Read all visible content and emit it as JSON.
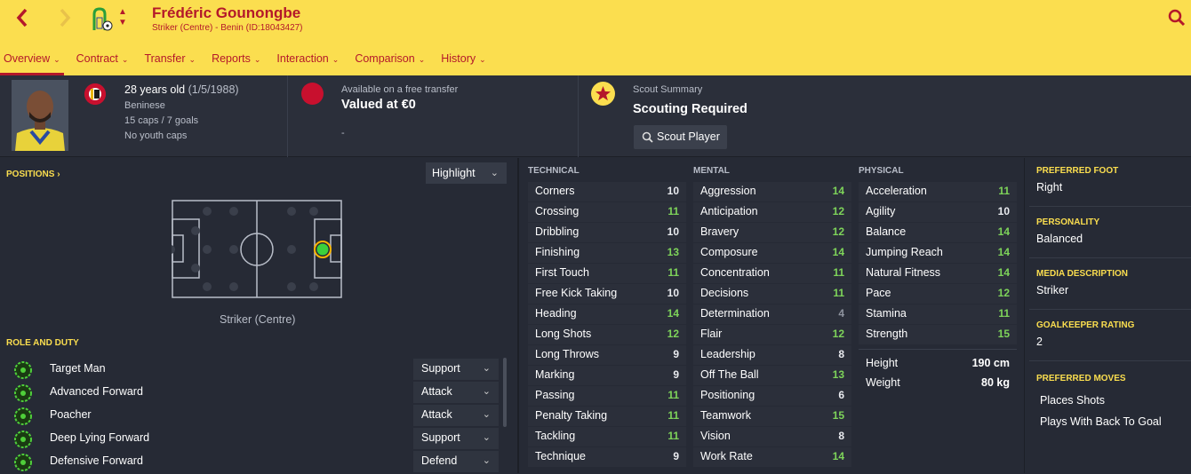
{
  "header": {
    "player_name": "Frédéric Gounongbe",
    "subtitle": "Striker (Centre) - Benin (ID:18043427)",
    "back_icon": "chevron-left-icon",
    "forward_icon": "chevron-right-icon",
    "accent": "#b4182a",
    "background": "#fbde4f"
  },
  "tabs": [
    {
      "label": "Overview",
      "active": true
    },
    {
      "label": "Contract"
    },
    {
      "label": "Transfer"
    },
    {
      "label": "Reports"
    },
    {
      "label": "Interaction"
    },
    {
      "label": "Comparison"
    },
    {
      "label": "History"
    }
  ],
  "profile": {
    "age": "28 years old",
    "dob": "(1/5/1988)",
    "nationality": "Beninese",
    "caps": "15 caps / 7 goals",
    "youth": "No youth caps"
  },
  "transfer": {
    "status": "Available on a free transfer",
    "value": "Valued at €0",
    "extra": "-"
  },
  "scout": {
    "label": "Scout Summary",
    "status": "Scouting Required",
    "button": "Scout Player"
  },
  "positions": {
    "label": "POSITIONS",
    "highlight": "Highlight",
    "position_name": "Striker (Centre)"
  },
  "roles": {
    "label": "ROLE AND DUTY",
    "items": [
      {
        "name": "Target Man",
        "duty": "Support"
      },
      {
        "name": "Advanced Forward",
        "duty": "Attack"
      },
      {
        "name": "Poacher",
        "duty": "Attack"
      },
      {
        "name": "Deep Lying Forward",
        "duty": "Support"
      },
      {
        "name": "Defensive Forward",
        "duty": "Defend"
      }
    ]
  },
  "attributes": {
    "technical_title": "TECHNICAL",
    "mental_title": "MENTAL",
    "physical_title": "PHYSICAL",
    "technical": [
      {
        "name": "Corners",
        "value": "10"
      },
      {
        "name": "Crossing",
        "value": "11"
      },
      {
        "name": "Dribbling",
        "value": "10"
      },
      {
        "name": "Finishing",
        "value": "13"
      },
      {
        "name": "First Touch",
        "value": "11"
      },
      {
        "name": "Free Kick Taking",
        "value": "10"
      },
      {
        "name": "Heading",
        "value": "14"
      },
      {
        "name": "Long Shots",
        "value": "12"
      },
      {
        "name": "Long Throws",
        "value": "9"
      },
      {
        "name": "Marking",
        "value": "9"
      },
      {
        "name": "Passing",
        "value": "11"
      },
      {
        "name": "Penalty Taking",
        "value": "11"
      },
      {
        "name": "Tackling",
        "value": "11"
      },
      {
        "name": "Technique",
        "value": "9"
      }
    ],
    "mental": [
      {
        "name": "Aggression",
        "value": "14"
      },
      {
        "name": "Anticipation",
        "value": "12"
      },
      {
        "name": "Bravery",
        "value": "12"
      },
      {
        "name": "Composure",
        "value": "14"
      },
      {
        "name": "Concentration",
        "value": "11"
      },
      {
        "name": "Decisions",
        "value": "11"
      },
      {
        "name": "Determination",
        "value": "4"
      },
      {
        "name": "Flair",
        "value": "12"
      },
      {
        "name": "Leadership",
        "value": "8"
      },
      {
        "name": "Off The Ball",
        "value": "13"
      },
      {
        "name": "Positioning",
        "value": "6"
      },
      {
        "name": "Teamwork",
        "value": "15"
      },
      {
        "name": "Vision",
        "value": "8"
      },
      {
        "name": "Work Rate",
        "value": "14"
      }
    ],
    "physical": [
      {
        "name": "Acceleration",
        "value": "11"
      },
      {
        "name": "Agility",
        "value": "10"
      },
      {
        "name": "Balance",
        "value": "14"
      },
      {
        "name": "Jumping Reach",
        "value": "14"
      },
      {
        "name": "Natural Fitness",
        "value": "14"
      },
      {
        "name": "Pace",
        "value": "12"
      },
      {
        "name": "Stamina",
        "value": "11"
      },
      {
        "name": "Strength",
        "value": "15"
      }
    ],
    "height_label": "Height",
    "height": "190 cm",
    "weight_label": "Weight",
    "weight": "80 kg"
  },
  "details": {
    "foot_label": "PREFERRED FOOT",
    "foot": "Right",
    "personality_label": "PERSONALITY",
    "personality": "Balanced",
    "media_label": "MEDIA DESCRIPTION",
    "media": "Striker",
    "gk_label": "GOALKEEPER RATING",
    "gk": "2",
    "moves_label": "PREFERRED MOVES",
    "moves": [
      "Places Shots",
      "Plays With Back To Goal"
    ]
  }
}
